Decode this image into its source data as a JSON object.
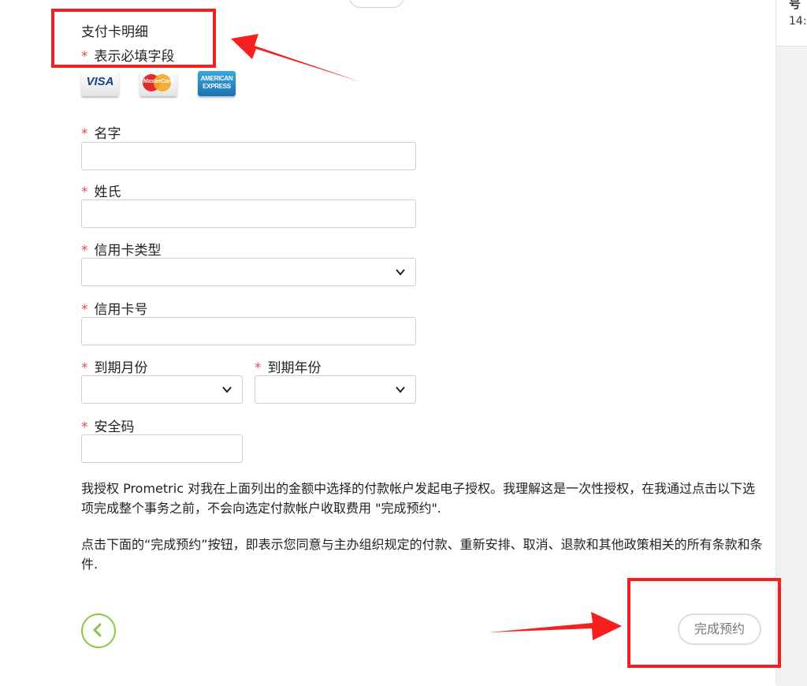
{
  "side_panel": {
    "top_fragment": "号",
    "time": "14:"
  },
  "form": {
    "section_title": "支付卡明细",
    "required_note": "表示必填字段",
    "required_mark": "*",
    "cards": [
      {
        "name": "visa",
        "text": "VISA"
      },
      {
        "name": "mastercard",
        "text": "MasterCard"
      },
      {
        "name": "amex",
        "text": "AMERICAN EXPRESS"
      }
    ],
    "fields": {
      "first_name": {
        "label": "名字",
        "value": ""
      },
      "last_name": {
        "label": "姓氏",
        "value": ""
      },
      "card_type": {
        "label": "信用卡类型",
        "value": ""
      },
      "card_number": {
        "label": "信用卡号",
        "value": ""
      },
      "expiry_month": {
        "label": "到期月份",
        "value": ""
      },
      "expiry_year": {
        "label": "到期年份",
        "value": ""
      },
      "security_code": {
        "label": "安全码",
        "value": ""
      }
    },
    "authorization_text": "我授权 Prometric 对我在上面列出的金额中选择的付款帐户发起电子授权。我理解这是一次性授权，在我通过点击以下选项完成整个事务之前，不会向选定付款帐户收取费用 \"完成预约\".",
    "agreement_text": "点击下面的“完成预约”按钮，即表示您同意与主办组织规定的付款、重新安排、取消、退款和其他政策相关的所有条款和条件."
  },
  "actions": {
    "complete_label": "完成预约"
  },
  "colors": {
    "annotation_red": "#f51f1f",
    "required_red": "#d9534f",
    "back_green": "#8cc63f"
  }
}
